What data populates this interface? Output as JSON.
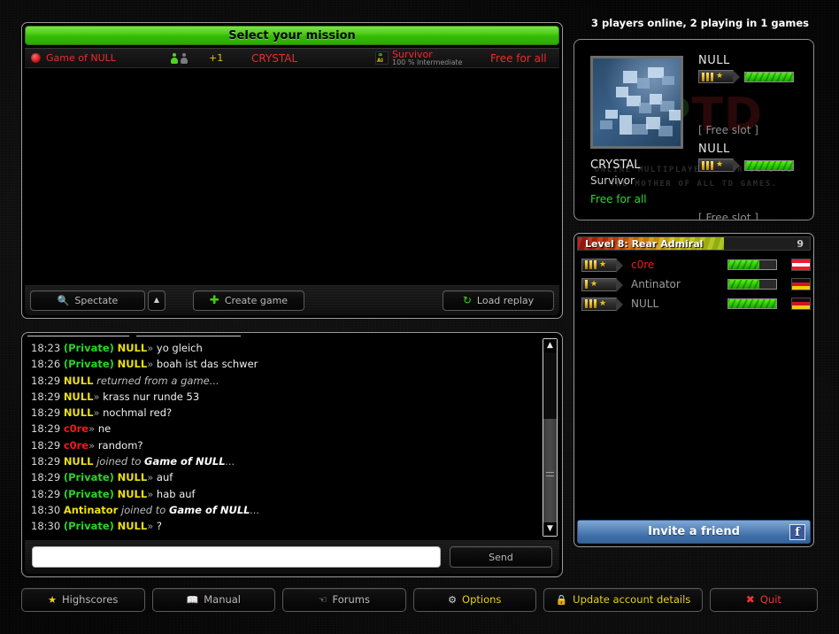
{
  "mission_panel": {
    "header_title": "Select your mission",
    "games": [
      {
        "name": "Game of NULL",
        "players_online": 1,
        "players_total": 2,
        "extra": "+1",
        "map": "CRYSTAL",
        "mode": "Survivor",
        "difficulty": "100 % Intermediate",
        "teams": "Free for all",
        "ai_icon": "ai-badge-icon",
        "status_icon": "red-dot-icon"
      }
    ],
    "toolbar": {
      "spectate_label": "Spectate",
      "spectate_icon": "search-icon",
      "spectate_more_icon": "triangle-up-icon",
      "create_label": "Create game",
      "create_icon": "plus-icon",
      "load_replay_label": "Load replay",
      "load_replay_icon": "replay-icon"
    }
  },
  "chat": {
    "messages": [
      {
        "time": "18:23",
        "private": "(Private)",
        "nick": "NULL",
        "nick_color": "yellow",
        "arrow": "»",
        "body": "yo gleich",
        "type": "chat"
      },
      {
        "time": "18:26",
        "private": "(Private)",
        "nick": "NULL",
        "nick_color": "yellow",
        "arrow": "»",
        "body": "boah ist das schwer",
        "type": "chat"
      },
      {
        "time": "18:29",
        "nick": "NULL",
        "nick_color": "yellow",
        "body": "returned from a game...",
        "type": "system"
      },
      {
        "time": "18:29",
        "nick": "NULL",
        "nick_color": "yellow",
        "arrow": "»",
        "body": "krass nur runde 53",
        "type": "chat"
      },
      {
        "time": "18:29",
        "nick": "NULL",
        "nick_color": "yellow",
        "arrow": "»",
        "body": "nochmal red?",
        "type": "chat"
      },
      {
        "time": "18:29",
        "nick": "c0re",
        "nick_color": "red",
        "arrow": "»",
        "body": "ne",
        "type": "chat"
      },
      {
        "time": "18:29",
        "nick": "c0re",
        "nick_color": "red",
        "arrow": "»",
        "body": "random?",
        "type": "chat"
      },
      {
        "time": "18:29",
        "nick": "NULL",
        "nick_color": "yellow",
        "body": "joined to",
        "target": "Game of NULL",
        "suffix": "...",
        "type": "system_target"
      },
      {
        "time": "18:29",
        "private": "(Private)",
        "nick": "NULL",
        "nick_color": "yellow",
        "arrow": "»",
        "body": "auf",
        "type": "chat"
      },
      {
        "time": "18:29",
        "private": "(Private)",
        "nick": "NULL",
        "nick_color": "yellow",
        "arrow": "»",
        "body": "hab auf",
        "type": "chat"
      },
      {
        "time": "18:30",
        "nick": "Antinator",
        "nick_color": "yellow",
        "body": "joined to",
        "target": "Game of NULL",
        "suffix": "...",
        "type": "system_target"
      },
      {
        "time": "18:30",
        "private": "(Private)",
        "nick": "NULL",
        "nick_color": "yellow",
        "arrow": "»",
        "body": "?",
        "type": "chat"
      }
    ],
    "input_value": "",
    "input_placeholder": "",
    "send_label": "Send",
    "scroll_up_icon": "triangle-up-icon",
    "scroll_down_icon": "triangle-down-icon"
  },
  "right": {
    "online_status": "3 players online, 2 playing in 1 games",
    "game_info": {
      "map_name": "CRYSTAL",
      "mode": "Survivor",
      "teams": "Free for all",
      "logo_part1": "EP",
      "logo_part2": "TD",
      "tagline1": "ONLINE MULTIPLAYER TOWER DEFENSE",
      "tagline2": "THE MOTHER OF ALL TD GAMES.",
      "slots": [
        {
          "name": "NULL",
          "rank_bars": 3,
          "xp_percent": 100
        },
        {
          "free_label": "[ Free slot ]"
        },
        {
          "name": "NULL",
          "rank_bars": 3,
          "xp_percent": 100
        },
        {
          "free_label": "[ Free slot ]"
        }
      ]
    },
    "player_list": {
      "level_label": "Level 8: Rear Admiral",
      "level_number": "9",
      "level_percent": 63,
      "players": [
        {
          "name": "c0re",
          "rank_bars": 3,
          "xp_percent": 64,
          "flag": "at",
          "self": true
        },
        {
          "name": "Antinator",
          "rank_bars": 1,
          "xp_percent": 64,
          "flag": "de",
          "self": false
        },
        {
          "name": "NULL",
          "rank_bars": 4,
          "xp_percent": 100,
          "flag": "de",
          "self": false
        }
      ]
    },
    "invite_label": "Invite a friend",
    "facebook_icon": "facebook-icon"
  },
  "bottom_bar": {
    "buttons": [
      {
        "label": "Highscores",
        "icon": "star-icon",
        "icon_class": "star",
        "label_class": ""
      },
      {
        "label": "Manual",
        "icon": "book-icon",
        "icon_class": "book",
        "label_class": ""
      },
      {
        "label": "Forums",
        "icon": "hand-icon",
        "icon_class": "hand",
        "label_class": ""
      },
      {
        "label": "Options",
        "icon": "gear-icon",
        "icon_class": "gear",
        "label_class": "lbl-y"
      },
      {
        "label": "Update account details",
        "icon": "lock-icon",
        "icon_class": "lock",
        "label_class": "lbl-y"
      },
      {
        "label": "Quit",
        "icon": "cross-icon",
        "icon_class": "cross",
        "label_class": "lbl-r"
      }
    ]
  },
  "colors": {
    "accent_green": "#3fd015",
    "accent_red": "#ee2b2b",
    "accent_yellow": "#ece00f",
    "facebook_blue": "#3b5998"
  }
}
